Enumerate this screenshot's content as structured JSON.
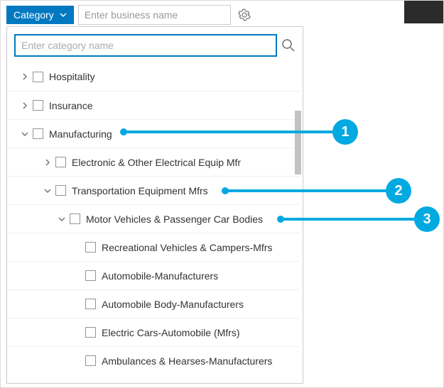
{
  "topbar": {
    "category_label": "Category",
    "business_placeholder": "Enter business name"
  },
  "search": {
    "placeholder": "Enter category name"
  },
  "tree": {
    "hospitality": "Hospitality",
    "insurance": "Insurance",
    "manufacturing": "Manufacturing",
    "electronic": "Electronic & Other Electrical Equip Mfr",
    "transport": "Transportation Equipment Mfrs",
    "motor": "Motor Vehicles & Passenger Car Bodies",
    "rec": "Recreational Vehicles & Campers-Mfrs",
    "auto_mfr": "Automobile-Manufacturers",
    "auto_body": "Automobile Body-Manufacturers",
    "electric_cars": "Electric Cars-Automobile (Mfrs)",
    "ambulances": "Ambulances & Hearses-Manufacturers"
  },
  "callouts": {
    "c1": "1",
    "c2": "2",
    "c3": "3"
  }
}
